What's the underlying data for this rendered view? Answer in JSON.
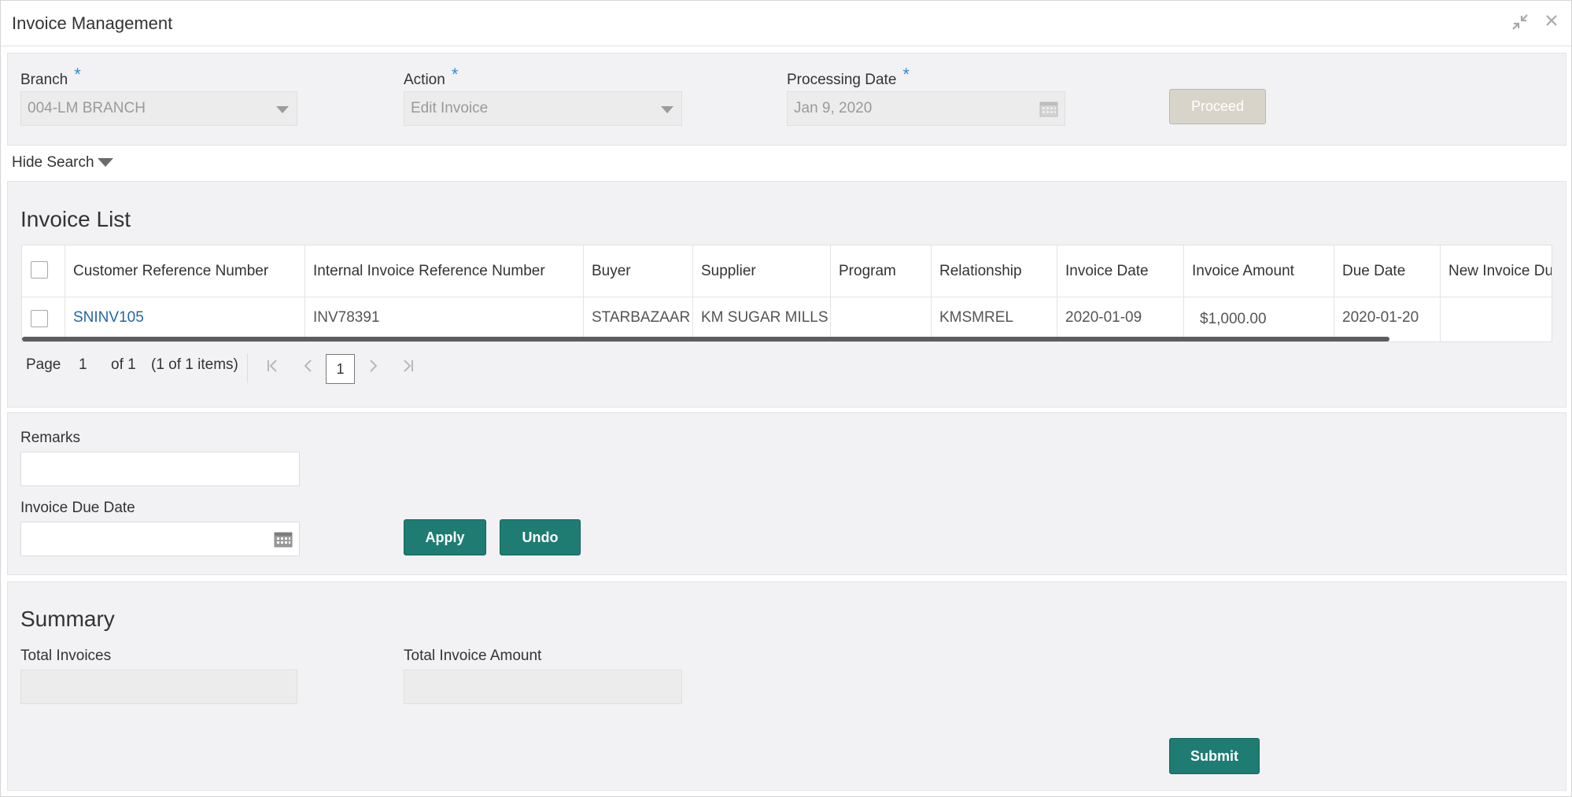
{
  "window": {
    "title": "Invoice Management",
    "minimize_icon": "collapse-arrows-icon",
    "close_icon": "close-icon"
  },
  "filters": {
    "branch": {
      "label": "Branch",
      "required": "*",
      "value": "004-LM BRANCH"
    },
    "action": {
      "label": "Action",
      "required": "*",
      "value": "Edit Invoice"
    },
    "processing_date": {
      "label": "Processing Date",
      "required": "*",
      "value": "Jan 9, 2020"
    },
    "proceed_label": "Proceed"
  },
  "hide_search_label": "Hide Search",
  "invoice_list": {
    "title": "Invoice List",
    "columns": [
      "Customer Reference Number",
      "Internal Invoice Reference Number",
      "Buyer",
      "Supplier",
      "Program",
      "Relationship",
      "Invoice Date",
      "Invoice Amount",
      "Due Date",
      "New Invoice Du"
    ],
    "rows": [
      {
        "customer_ref": "SNINV105",
        "internal_ref": "INV78391",
        "buyer": "STARBAZAAR",
        "supplier": "KM SUGAR MILLS",
        "program": "",
        "relationship": "KMSMREL",
        "invoice_date": "2020-01-09",
        "invoice_amount": "$1,000.00",
        "due_date": "2020-01-20",
        "new_invoice_due": ""
      }
    ],
    "pager": {
      "page_label": "Page",
      "page_value": "1",
      "of_label": "of 1",
      "items_label": "(1 of 1 items)",
      "current_page": "1"
    }
  },
  "edit": {
    "remarks_label": "Remarks",
    "remarks_value": "",
    "due_date_label": "Invoice Due Date",
    "due_date_value": "",
    "apply_label": "Apply",
    "undo_label": "Undo"
  },
  "summary": {
    "title": "Summary",
    "total_invoices_label": "Total Invoices",
    "total_invoices_value": "",
    "total_amount_label": "Total Invoice Amount",
    "total_amount_value": "",
    "submit_label": "Submit"
  }
}
